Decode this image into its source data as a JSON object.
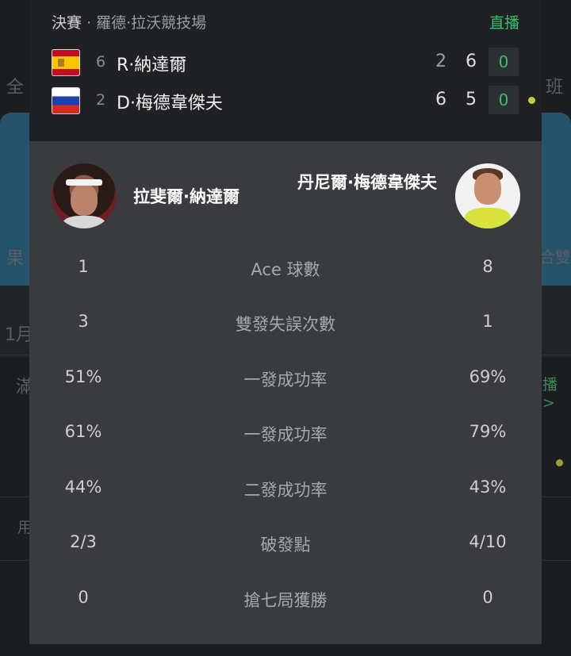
{
  "background": {
    "glimpses": [
      "全",
      "班",
      "果",
      "合雙",
      "1月",
      "滿",
      "播 >",
      "用"
    ]
  },
  "match": {
    "stage": "決賽",
    "venue": "· 羅德·拉沃競技場",
    "status": "直播"
  },
  "players": [
    {
      "flag": "spain-flag",
      "seed": "6",
      "short_name": "R·納達爾",
      "sets": [
        "2",
        "6"
      ],
      "game": "0",
      "serving": false
    },
    {
      "flag": "russia-flag",
      "seed": "2",
      "short_name": "D·梅德韋傑夫",
      "sets": [
        "6",
        "5"
      ],
      "game": "0",
      "serving": true
    }
  ],
  "full_names": {
    "left": "拉斐爾·納達爾",
    "right": "丹尼爾·梅德韋傑夫"
  },
  "stats": [
    {
      "label": "Ace 球數",
      "left": "1",
      "right": "8"
    },
    {
      "label": "雙發失誤次數",
      "left": "3",
      "right": "1"
    },
    {
      "label": "一發成功率",
      "left": "51%",
      "right": "69%"
    },
    {
      "label": "一發成功率",
      "left": "61%",
      "right": "79%"
    },
    {
      "label": "二發成功率",
      "left": "44%",
      "right": "43%"
    },
    {
      "label": "破發點",
      "left": "2/3",
      "right": "4/10"
    },
    {
      "label": "搶七局獲勝",
      "left": "0",
      "right": "0"
    }
  ],
  "colors": {
    "live_green": "#3dbf6a",
    "serve_dot": "#c6d22a",
    "modal_bg": "#3a3b3f",
    "header_bg": "#202124"
  }
}
